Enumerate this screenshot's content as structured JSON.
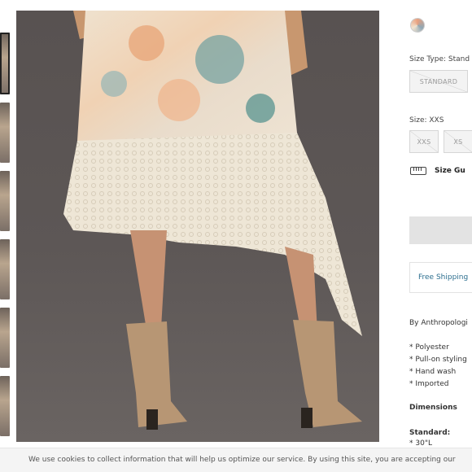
{
  "product": {
    "size_type_label": "Size Type: Stand",
    "size_type_options": [
      "STANDARD"
    ],
    "size_label": "Size: XXS",
    "size_options": [
      "XXS",
      "XS"
    ],
    "size_guide_label": "Size Gu",
    "free_shipping": "Free Shipping",
    "brand": "By Anthropologi",
    "details": [
      "* Polyester",
      "* Pull-on styling",
      "* Hand wash",
      "* Imported"
    ],
    "dimensions_heading": "Dimensions",
    "standard_heading": "Standard:",
    "standard_value": "* 30\"L"
  },
  "cookie_bar": {
    "text": "We use cookies to collect information that will help us optimize our service. By using this site, you are accepting our"
  },
  "colors": {
    "link": "#2d6f8f",
    "disabled_option": "#f3f3f3"
  }
}
